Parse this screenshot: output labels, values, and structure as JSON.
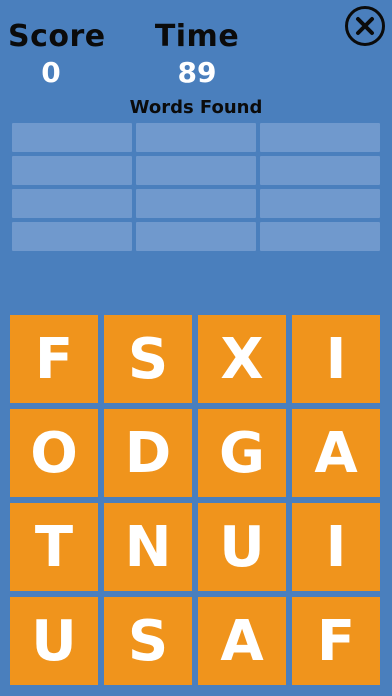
{
  "header": {
    "score_label": "Score",
    "score_value": "0",
    "time_label": "Time",
    "time_value": "89",
    "close_icon": "close-x-icon"
  },
  "words_found": {
    "title": "Words Found",
    "slots": [
      "",
      "",
      "",
      "",
      "",
      "",
      "",
      "",
      "",
      "",
      "",
      ""
    ]
  },
  "board": {
    "tiles": [
      "F",
      "S",
      "X",
      "I",
      "O",
      "D",
      "G",
      "A",
      "T",
      "N",
      "U",
      "I",
      "U",
      "S",
      "A",
      "F"
    ]
  },
  "colors": {
    "background": "#4a7fbd",
    "slot": "#7099cd",
    "tile": "#f0941c",
    "tile_text": "#ffffff",
    "label_text": "#0b0b0b"
  }
}
